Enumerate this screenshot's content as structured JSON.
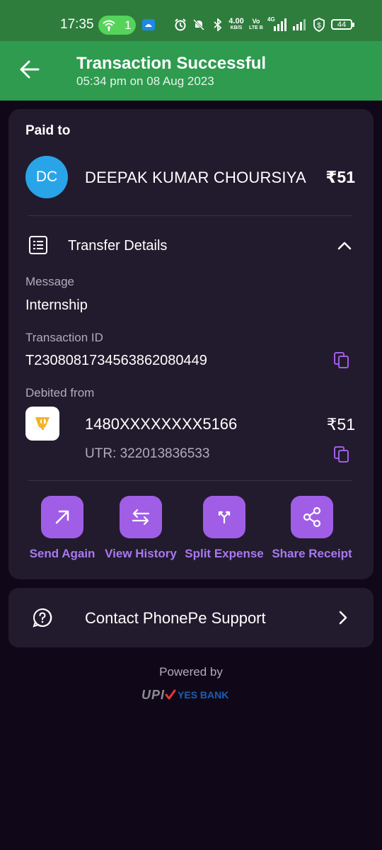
{
  "status_bar": {
    "time": "17:35",
    "hotspot_count": "1",
    "net_speed_value": "4.00",
    "net_speed_unit": "KB/S",
    "volte_top": "Vo",
    "volte_bottom": "LTE B",
    "network_type": "4G",
    "battery": "44"
  },
  "header": {
    "title": "Transaction Successful",
    "subtitle": "05:34 pm on 08 Aug 2023",
    "bg_color": "#2e9b4f"
  },
  "paid_to": {
    "label": "Paid to",
    "initials": "DC",
    "name": "DEEPAK KUMAR CHOURSIYA",
    "amount": "₹51"
  },
  "transfer_details": {
    "label": "Transfer Details",
    "message_label": "Message",
    "message_value": "Internship",
    "txn_id_label": "Transaction ID",
    "txn_id_value": "T2308081734563862080449",
    "debited_label": "Debited from",
    "account": "1480XXXXXXXX5166",
    "account_amount": "₹51",
    "utr": "UTR: 322013836533"
  },
  "actions": [
    {
      "label": "Send Again",
      "icon": "arrow-up-right-icon"
    },
    {
      "label": "View History",
      "icon": "swap-arrows-icon"
    },
    {
      "label": "Split Expense",
      "icon": "split-icon"
    },
    {
      "label": "Share Receipt",
      "icon": "share-icon"
    }
  ],
  "support": {
    "label": "Contact PhonePe Support"
  },
  "footer": {
    "powered_by": "Powered by",
    "upi": "UPI",
    "bank": "YES BANK"
  },
  "colors": {
    "accent": "#a05ee6",
    "card": "#221b2d",
    "background": "#100818"
  }
}
